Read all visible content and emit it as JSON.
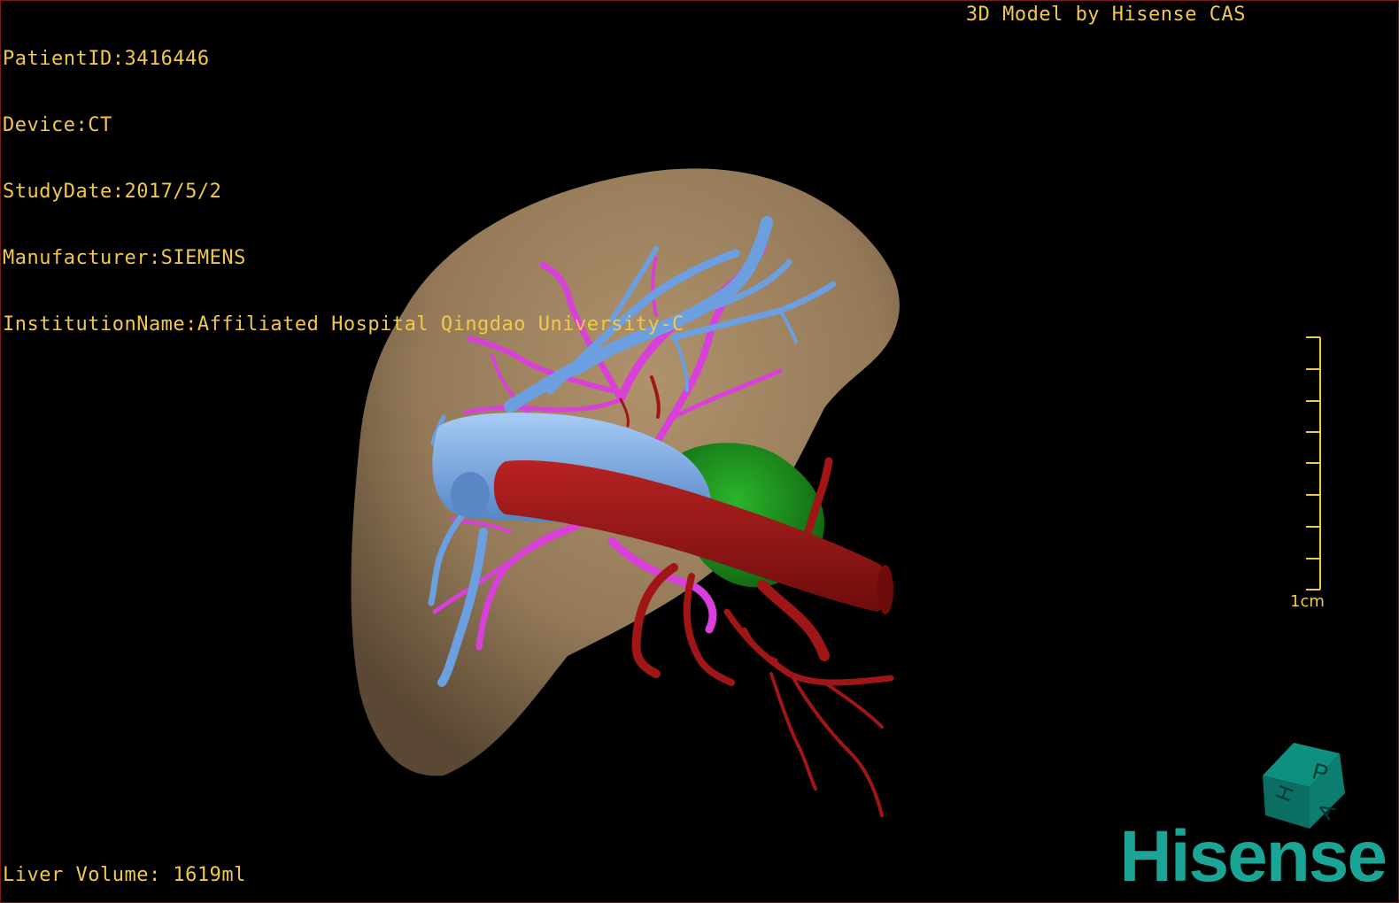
{
  "header": {
    "patient_id": "PatientID:3416446",
    "device": "Device:CT",
    "study_date": "StudyDate:2017/5/2",
    "manufacturer": "Manufacturer:SIEMENS",
    "institution": "InstitutionName:Affiliated Hospital Qingdao University-C"
  },
  "brand_caption": "3D Model by Hisense CAS",
  "scale_bar": {
    "label": "1cm"
  },
  "orientation_cube": {
    "face_labels": [
      "P",
      "H",
      "A"
    ]
  },
  "footer": {
    "liver_volume": "Liver Volume: 1619ml"
  },
  "logo": {
    "text": "Hisense"
  },
  "colors": {
    "overlay_text": "#f2c84a",
    "liver": "#a08562",
    "portal_vein": "#6b9fe0",
    "hepatic_vein": "#d93fd9",
    "artery": "#a01616",
    "green_structure": "#1e9a1e",
    "logo": "#1aa596"
  }
}
